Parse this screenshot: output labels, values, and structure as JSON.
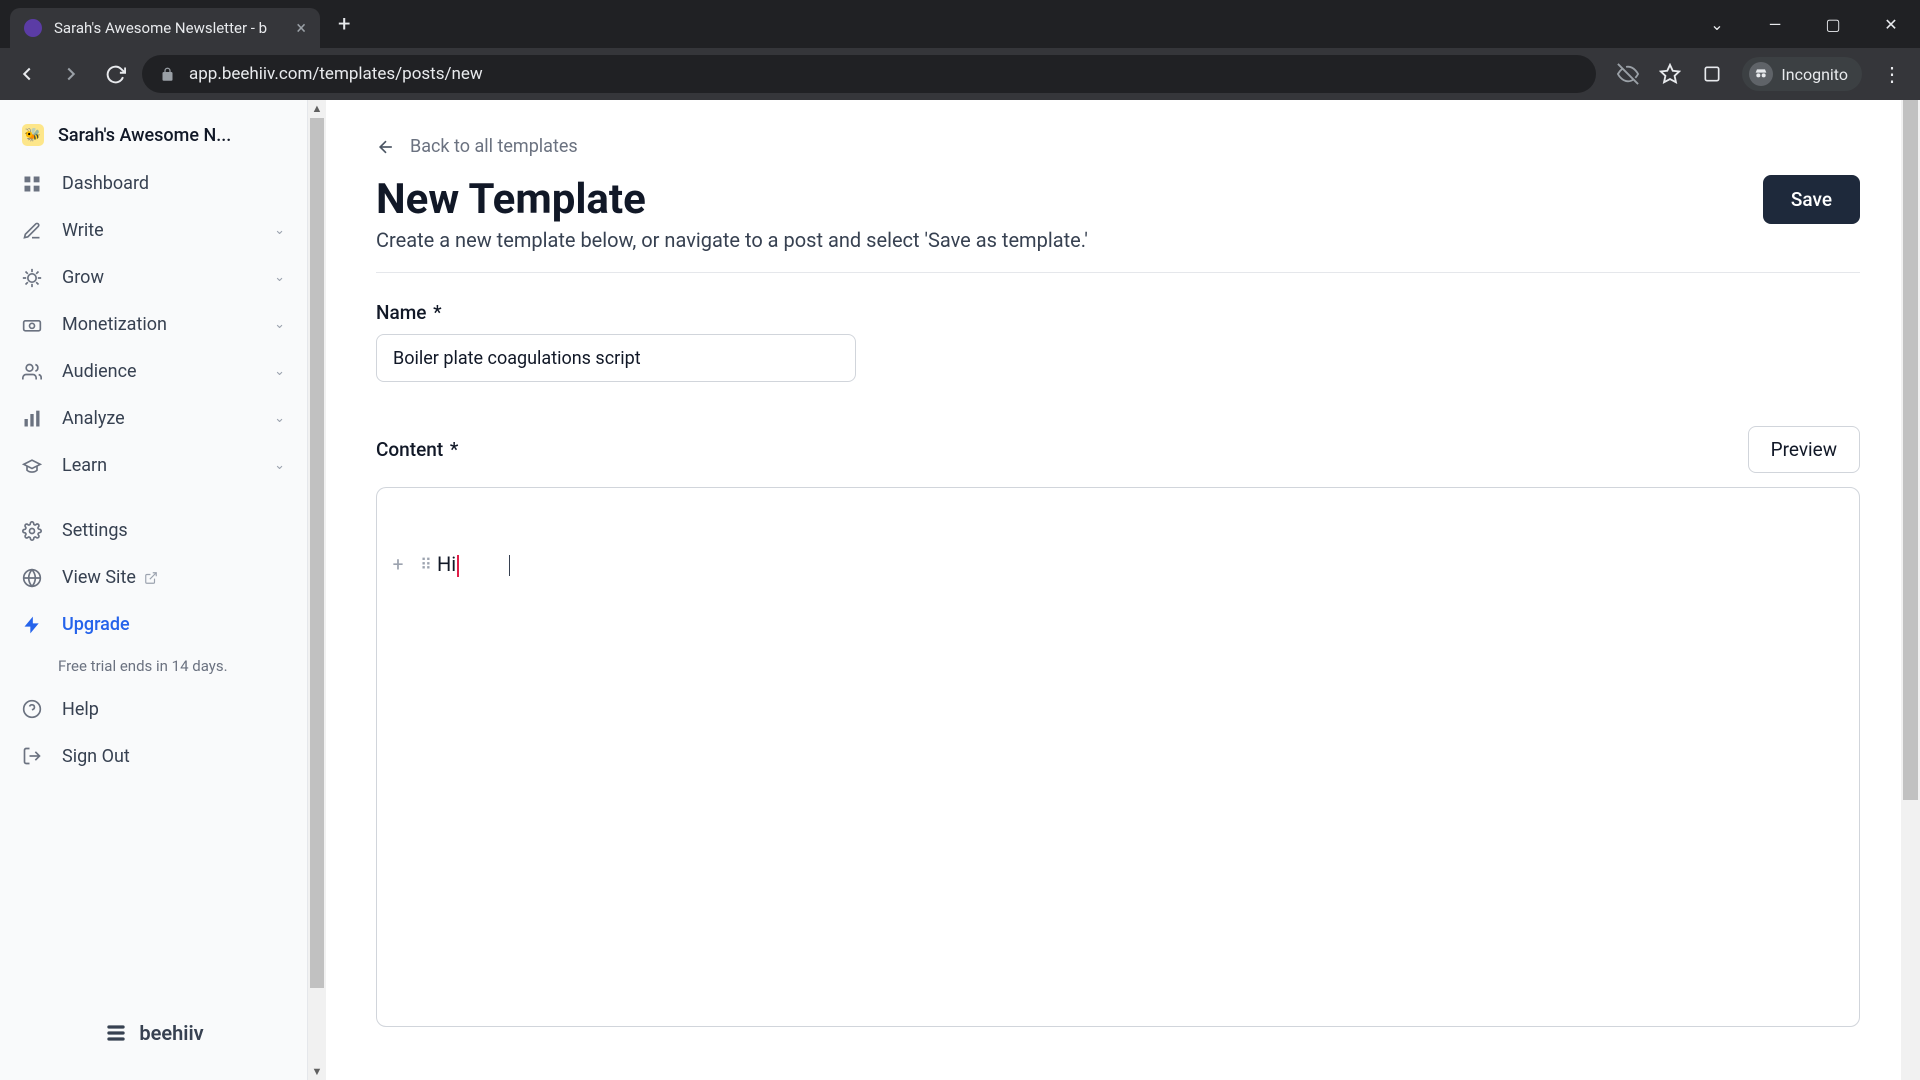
{
  "browser": {
    "tab_title": "Sarah's Awesome Newsletter - b",
    "url": "app.beehiiv.com/templates/posts/new",
    "incognito_label": "Incognito"
  },
  "sidebar": {
    "workspace": "Sarah's Awesome N...",
    "items": [
      {
        "label": "Dashboard",
        "expandable": false
      },
      {
        "label": "Write",
        "expandable": true
      },
      {
        "label": "Grow",
        "expandable": true
      },
      {
        "label": "Monetization",
        "expandable": true
      },
      {
        "label": "Audience",
        "expandable": true
      },
      {
        "label": "Analyze",
        "expandable": true
      },
      {
        "label": "Learn",
        "expandable": true
      }
    ],
    "settings": "Settings",
    "view_site": "View Site",
    "upgrade": "Upgrade",
    "trial_text": "Free trial ends in 14 days.",
    "help": "Help",
    "sign_out": "Sign Out",
    "brand": "beehiiv"
  },
  "main": {
    "back_link": "Back to all templates",
    "title": "New Template",
    "subtitle": "Create a new template below, or navigate to a post and select 'Save as template.'",
    "save_button": "Save",
    "name_label": "Name",
    "name_value": "Boiler plate coagulations script",
    "content_label": "Content",
    "preview_button": "Preview",
    "editor_text": "Hi"
  }
}
